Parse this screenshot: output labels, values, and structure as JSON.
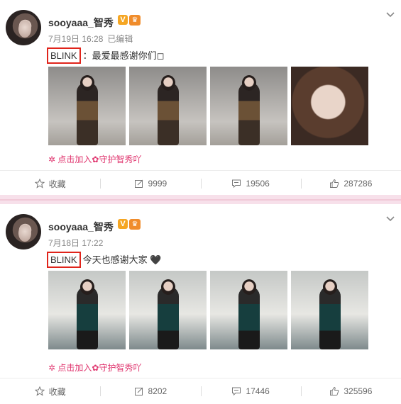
{
  "posts": [
    {
      "username": "sooyaaa_智秀",
      "vip_badge": "V",
      "crown_badge": "♛",
      "date": "7月19日 16:28",
      "edited": "已编辑",
      "highlight": "BLINK",
      "text": "：最爱最感谢你们◻",
      "add_link": "✲ 点击加入✿守护智秀吖",
      "actions": {
        "favorite": "收藏",
        "repost": "9999",
        "comment": "19506",
        "like": "287286"
      }
    },
    {
      "username": "sooyaaa_智秀",
      "vip_badge": "V",
      "crown_badge": "♛",
      "date": "7月18日 17:22",
      "edited": "",
      "highlight": "BLINK",
      "text": "今天也感谢大家 🖤",
      "add_link": "✲ 点击加入✿守护智秀吖",
      "actions": {
        "favorite": "收藏",
        "repost": "8202",
        "comment": "17446",
        "like": "325596"
      }
    }
  ],
  "icons": {
    "favorite": "star-icon",
    "repost": "repost-icon",
    "comment": "comment-icon",
    "like": "thumbs-up-icon",
    "menu": "chevron-down-icon"
  },
  "colors": {
    "highlight_box": "#e0241b",
    "link": "#e0366f",
    "divider": "#f7e0ea"
  }
}
